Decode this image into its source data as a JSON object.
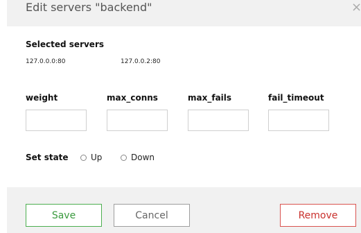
{
  "dialog": {
    "title": "Edit servers \"backend\"",
    "close_glyph": "×"
  },
  "selected": {
    "label": "Selected servers",
    "servers": [
      "127.0.0.0:80",
      "127.0.0.2:80"
    ]
  },
  "fields": [
    {
      "label": "weight",
      "value": ""
    },
    {
      "label": "max_conns",
      "value": ""
    },
    {
      "label": "max_fails",
      "value": ""
    },
    {
      "label": "fail_timeout",
      "value": ""
    }
  ],
  "state": {
    "label": "Set state",
    "options": [
      {
        "label": "Up",
        "selected": false
      },
      {
        "label": "Down",
        "selected": false
      }
    ]
  },
  "buttons": {
    "save": "Save",
    "cancel": "Cancel",
    "remove": "Remove"
  },
  "colors": {
    "save": "#4caf50",
    "cancel": "#9e9e9e",
    "remove": "#d9534f"
  },
  "icons": {
    "close": "close-icon",
    "radio": "radio-icon"
  }
}
